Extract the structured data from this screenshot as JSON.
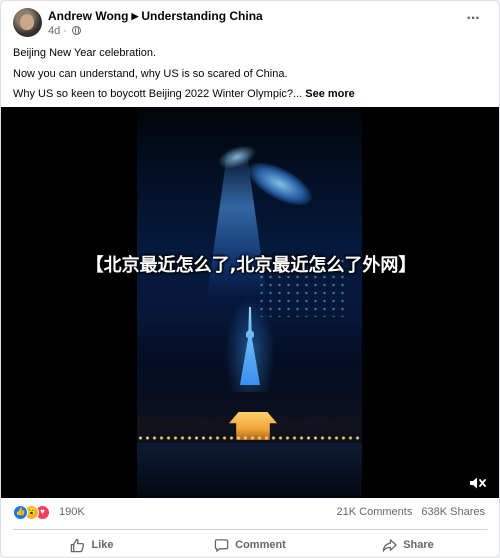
{
  "post": {
    "author": "Andrew Wong",
    "group": "Understanding China",
    "time": "4d",
    "privacy_icon": "globe-icon",
    "text_lines": [
      "Beijing New Year celebration.",
      "Now you can understand, why US is so scared of China.",
      "Why US so keen to boycott Beijing 2022 Winter Olympic?..."
    ],
    "see_more": "See more"
  },
  "media": {
    "caption": "【北京最近怎么了,北京最近怎么了外网】",
    "volume_icon": "speaker-muted-icon"
  },
  "stats": {
    "reaction_count": "190K",
    "comments": "21K Comments",
    "shares": "638K Shares",
    "reactions": [
      "like",
      "wow",
      "love"
    ]
  },
  "actions": {
    "like": "Like",
    "comment": "Comment",
    "share": "Share"
  },
  "colors": {
    "brand_blue": "#1877f2",
    "secondary_text": "#65676b",
    "love_red": "#f33e58",
    "wow_yellow": "#f7b125"
  }
}
